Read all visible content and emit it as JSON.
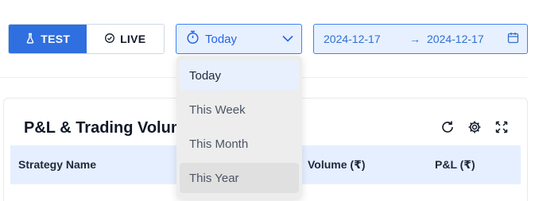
{
  "mode_toggle": {
    "test_label": "TEST",
    "live_label": "LIVE",
    "active": "TEST"
  },
  "range_select": {
    "value": "Today",
    "options": [
      "Today",
      "This Week",
      "This Month",
      "This Year"
    ],
    "selected_index": 0,
    "hover_index": 3
  },
  "date_range": {
    "start": "2024-12-17",
    "separator": "→",
    "end": "2024-12-17"
  },
  "card": {
    "title": "P&L & Trading Volume",
    "columns": [
      "Strategy Name",
      "Volume (₹)",
      "P&L (₹)"
    ]
  },
  "colors": {
    "accent": "#2f6fe0",
    "select_bg": "#e7f0ff",
    "table_head_bg": "#e5efff"
  },
  "icons": [
    "flask-icon",
    "live-signal-icon",
    "stopwatch-icon",
    "chevron-down-icon",
    "calendar-icon",
    "refresh-icon",
    "gear-icon",
    "expand-icon"
  ]
}
